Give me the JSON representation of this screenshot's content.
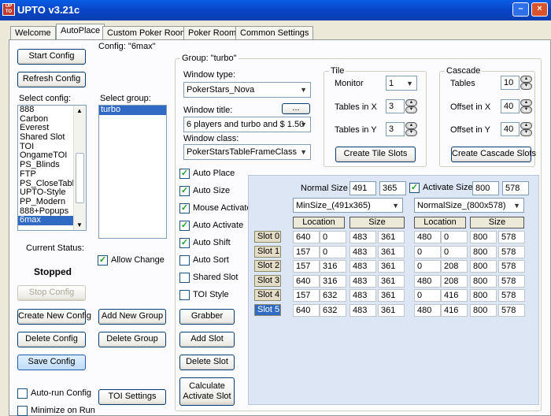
{
  "window": {
    "title": "UPTO  v3.21c",
    "logo_text": "UP TO"
  },
  "tabs": [
    "Welcome",
    "AutoPlace",
    "Custom Poker Room",
    "Poker Room",
    "Common Settings"
  ],
  "left": {
    "start_config": "Start Config",
    "refresh_config": "Refresh Config",
    "select_config_label": "Select config:",
    "configs": [
      "888",
      "Carbon",
      "Everest",
      "Shared Slot",
      "TOI",
      "OngameTOI",
      "PS_Blinds",
      "FTP",
      "PS_CloseTable",
      "UPTO-Style",
      "PP_Modern",
      "888+Popups",
      "6max"
    ],
    "selected_config": "6max",
    "status_label": "Current Status:",
    "status_value": "Stopped",
    "stop_config": "Stop Config",
    "create_new_config": "Create New Config",
    "delete_config": "Delete Config",
    "save_config": "Save Config",
    "autorun": "Auto-run Config",
    "minimize": "Minimize on Run"
  },
  "config_group": {
    "title": "Config: \"6max\"",
    "select_group_label": "Select group:",
    "groups": [
      "turbo"
    ],
    "allow_change": "Allow Change",
    "add_new_group": "Add New Group",
    "delete_group": "Delete Group",
    "toi_settings": "TOI Settings"
  },
  "group": {
    "title": "Group: \"turbo\"",
    "window_type_label": "Window type:",
    "window_type": "PokerStars_Nova",
    "window_title_label": "Window title:",
    "window_title_btn": "...",
    "window_title": "6 players and turbo and $ 1.50",
    "window_class_label": "Window class:",
    "window_class": "PokerStarsTableFrameClass",
    "options": [
      {
        "label": "Auto Place",
        "checked": true
      },
      {
        "label": "Auto Size",
        "checked": true
      },
      {
        "label": "Mouse Activate",
        "checked": true
      },
      {
        "label": "Auto Activate",
        "checked": true
      },
      {
        "label": "Auto Shift",
        "checked": true
      },
      {
        "label": "Auto Sort",
        "checked": false
      },
      {
        "label": "Shared Slot",
        "checked": false
      },
      {
        "label": "TOI Style",
        "checked": false
      }
    ],
    "grabber": "Grabber",
    "add_slot": "Add Slot",
    "delete_slot": "Delete Slot",
    "calculate_slot": [
      "Calculate",
      "Activate Slot"
    ]
  },
  "tile": {
    "title": "Tile",
    "monitor_label": "Monitor",
    "monitor": "1",
    "tiles_x_label": "Tables in X",
    "tiles_x": "3",
    "tiles_y_label": "Tables in Y",
    "tiles_y": "3",
    "create": "Create Tile Slots"
  },
  "cascade": {
    "title": "Cascade",
    "tables_label": "Tables",
    "tables": "10",
    "offset_x_label": "Offset in X",
    "offset_x": "40",
    "offset_y_label": "Offset in Y",
    "offset_y": "40",
    "create": "Create Cascade Slots"
  },
  "slots": {
    "normal_size_label": "Normal Size",
    "normal_w": "491",
    "normal_h": "365",
    "activate_size_label": "Activate Size",
    "activate_w": "800",
    "activate_h": "578",
    "min_size_dd": "MinSize_(491x365)",
    "normal_size_dd": "NormalSize_(800x578)",
    "location_hdr": "Location",
    "size_hdr": "Size",
    "selected": "Slot 5",
    "rows": [
      {
        "name": "Slot 0",
        "v": [
          "640",
          "0",
          "483",
          "361",
          "480",
          "0",
          "800",
          "578"
        ]
      },
      {
        "name": "Slot 1",
        "v": [
          "157",
          "0",
          "483",
          "361",
          "0",
          "0",
          "800",
          "578"
        ]
      },
      {
        "name": "Slot 2",
        "v": [
          "157",
          "316",
          "483",
          "361",
          "0",
          "208",
          "800",
          "578"
        ]
      },
      {
        "name": "Slot 3",
        "v": [
          "640",
          "316",
          "483",
          "361",
          "480",
          "208",
          "800",
          "578"
        ]
      },
      {
        "name": "Slot 4",
        "v": [
          "157",
          "632",
          "483",
          "361",
          "0",
          "416",
          "800",
          "578"
        ]
      },
      {
        "name": "Slot 5",
        "v": [
          "640",
          "632",
          "483",
          "361",
          "480",
          "416",
          "800",
          "578"
        ]
      }
    ]
  }
}
